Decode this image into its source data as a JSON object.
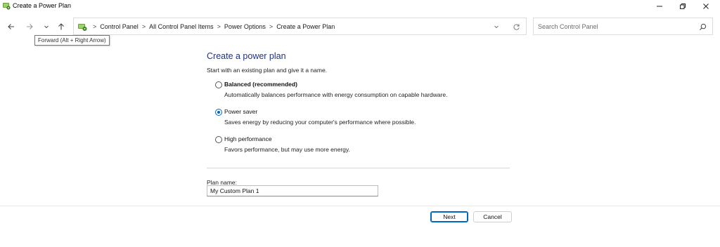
{
  "window": {
    "title": "Create a Power Plan",
    "icon": "control-panel-icon"
  },
  "nav": {
    "back_icon": "arrow-left-icon",
    "forward_icon": "arrow-right-icon",
    "recent_icon": "chevron-down-icon",
    "up_icon": "arrow-up-icon",
    "forward_tooltip": "Forward (Alt + Right Arrow)"
  },
  "address": {
    "crumbs": [
      "Control Panel",
      "All Control Panel Items",
      "Power Options",
      "Create a Power Plan"
    ],
    "separator": ">"
  },
  "search": {
    "placeholder": "Search Control Panel"
  },
  "main": {
    "heading": "Create a power plan",
    "subheading": "Start with an existing plan and give it a name.",
    "plans": [
      {
        "label": "Balanced (recommended)",
        "description": "Automatically balances performance with energy consumption on capable hardware.",
        "selected": false
      },
      {
        "label": "Power saver",
        "description": "Saves energy by reducing your computer's performance where possible.",
        "selected": true
      },
      {
        "label": "High performance",
        "description": "Favors performance, but may use more energy.",
        "selected": false
      }
    ],
    "plan_name_label": "Plan name:",
    "plan_name_value": "My Custom Plan 1"
  },
  "buttons": {
    "next": "Next",
    "cancel": "Cancel"
  },
  "colors": {
    "heading": "#1e3287",
    "accent": "#0067c0"
  }
}
